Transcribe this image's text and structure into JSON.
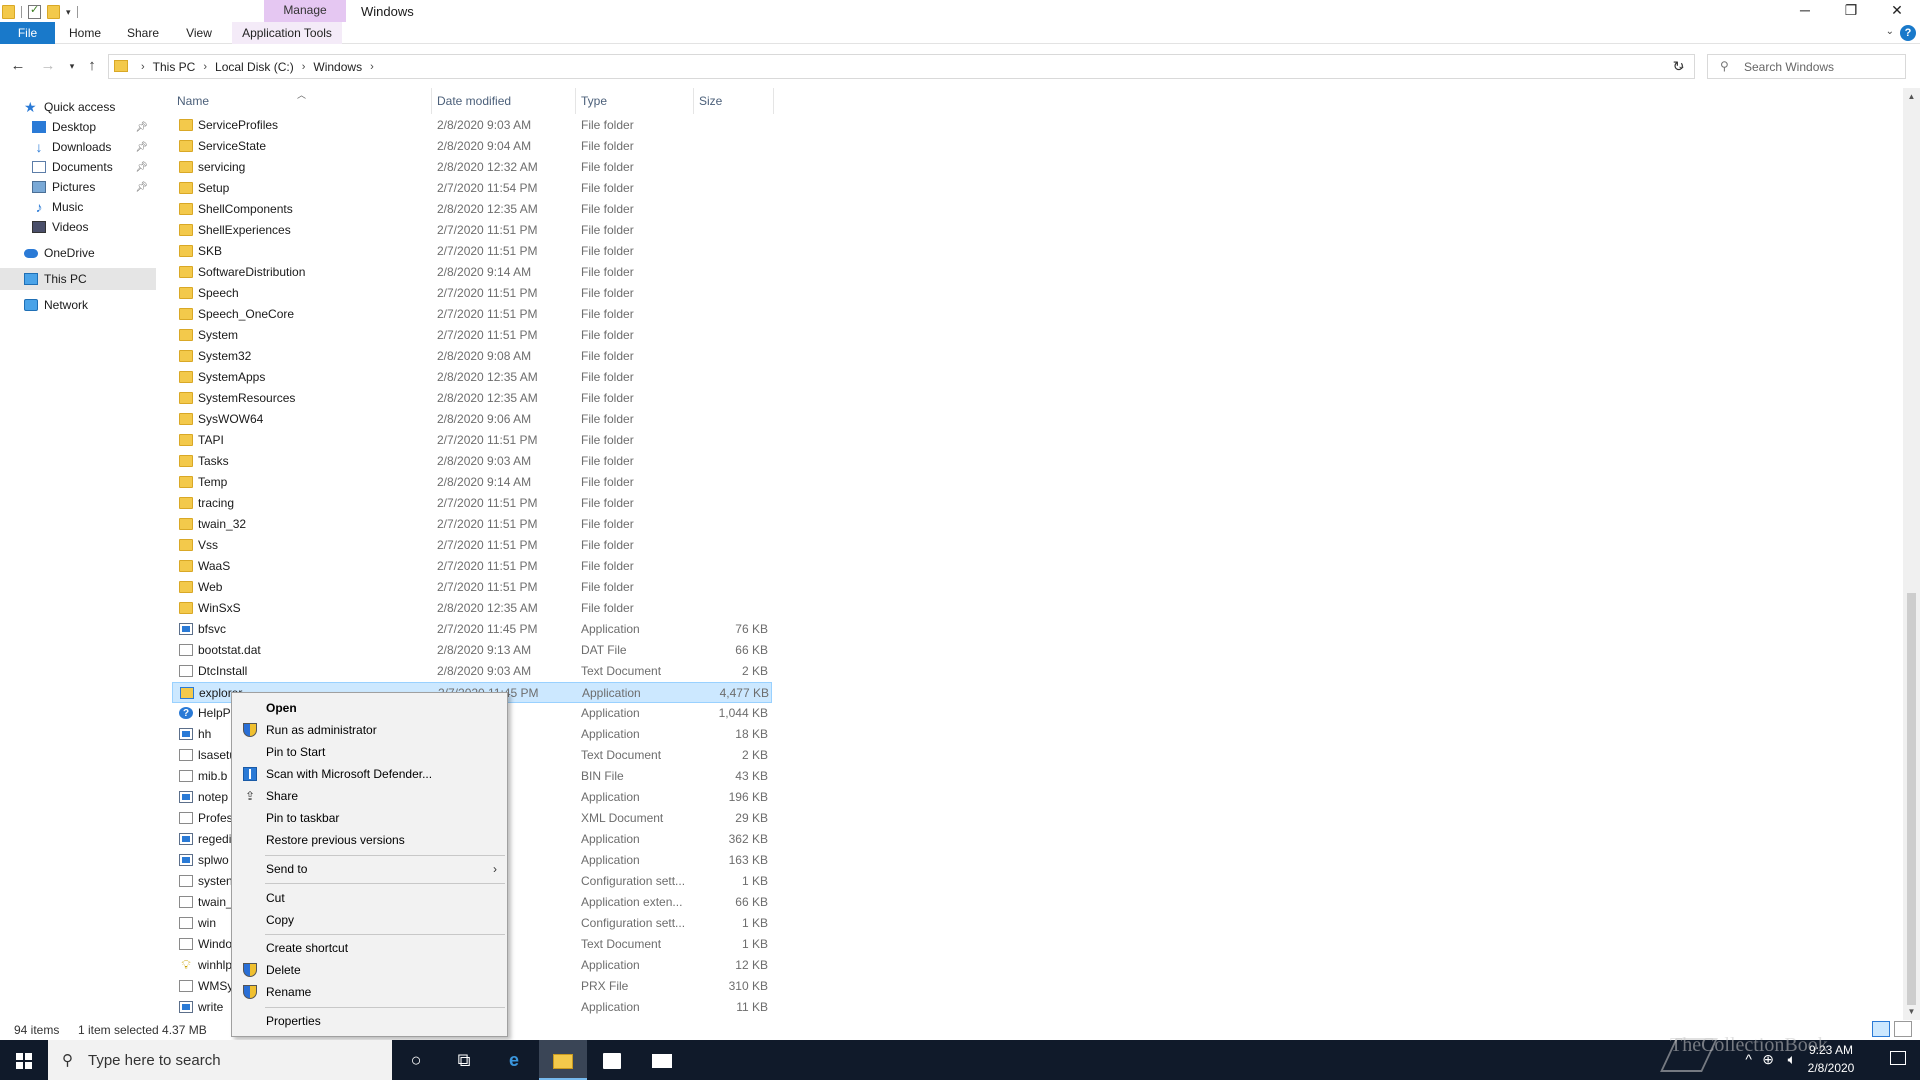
{
  "window": {
    "title": "Windows",
    "manage_tab": "Manage",
    "controls": {
      "minimize": "─",
      "restore": "❐",
      "close": "✕"
    }
  },
  "ribbon": {
    "file": "File",
    "home": "Home",
    "share": "Share",
    "view": "View",
    "app_tools": "Application Tools",
    "help": "?"
  },
  "address": {
    "crumbs": [
      "This PC",
      "Local Disk (C:)",
      "Windows"
    ],
    "search_placeholder": "Search Windows"
  },
  "nav": {
    "quick_access": "Quick access",
    "desktop": "Desktop",
    "downloads": "Downloads",
    "documents": "Documents",
    "pictures": "Pictures",
    "music": "Music",
    "videos": "Videos",
    "onedrive": "OneDrive",
    "this_pc": "This PC",
    "network": "Network"
  },
  "columns": {
    "name": "Name",
    "date": "Date modified",
    "type": "Type",
    "size": "Size"
  },
  "files": [
    {
      "name": "ServiceProfiles",
      "date": "2/8/2020 9:03 AM",
      "type": "File folder",
      "size": "",
      "icon": "folder"
    },
    {
      "name": "ServiceState",
      "date": "2/8/2020 9:04 AM",
      "type": "File folder",
      "size": "",
      "icon": "folder"
    },
    {
      "name": "servicing",
      "date": "2/8/2020 12:32 AM",
      "type": "File folder",
      "size": "",
      "icon": "folder"
    },
    {
      "name": "Setup",
      "date": "2/7/2020 11:54 PM",
      "type": "File folder",
      "size": "",
      "icon": "folder"
    },
    {
      "name": "ShellComponents",
      "date": "2/8/2020 12:35 AM",
      "type": "File folder",
      "size": "",
      "icon": "folder"
    },
    {
      "name": "ShellExperiences",
      "date": "2/7/2020 11:51 PM",
      "type": "File folder",
      "size": "",
      "icon": "folder"
    },
    {
      "name": "SKB",
      "date": "2/7/2020 11:51 PM",
      "type": "File folder",
      "size": "",
      "icon": "folder"
    },
    {
      "name": "SoftwareDistribution",
      "date": "2/8/2020 9:14 AM",
      "type": "File folder",
      "size": "",
      "icon": "folder"
    },
    {
      "name": "Speech",
      "date": "2/7/2020 11:51 PM",
      "type": "File folder",
      "size": "",
      "icon": "folder"
    },
    {
      "name": "Speech_OneCore",
      "date": "2/7/2020 11:51 PM",
      "type": "File folder",
      "size": "",
      "icon": "folder"
    },
    {
      "name": "System",
      "date": "2/7/2020 11:51 PM",
      "type": "File folder",
      "size": "",
      "icon": "folder"
    },
    {
      "name": "System32",
      "date": "2/8/2020 9:08 AM",
      "type": "File folder",
      "size": "",
      "icon": "folder"
    },
    {
      "name": "SystemApps",
      "date": "2/8/2020 12:35 AM",
      "type": "File folder",
      "size": "",
      "icon": "folder"
    },
    {
      "name": "SystemResources",
      "date": "2/8/2020 12:35 AM",
      "type": "File folder",
      "size": "",
      "icon": "folder"
    },
    {
      "name": "SysWOW64",
      "date": "2/8/2020 9:06 AM",
      "type": "File folder",
      "size": "",
      "icon": "folder"
    },
    {
      "name": "TAPI",
      "date": "2/7/2020 11:51 PM",
      "type": "File folder",
      "size": "",
      "icon": "folder"
    },
    {
      "name": "Tasks",
      "date": "2/8/2020 9:03 AM",
      "type": "File folder",
      "size": "",
      "icon": "folder"
    },
    {
      "name": "Temp",
      "date": "2/8/2020 9:14 AM",
      "type": "File folder",
      "size": "",
      "icon": "folder"
    },
    {
      "name": "tracing",
      "date": "2/7/2020 11:51 PM",
      "type": "File folder",
      "size": "",
      "icon": "folder"
    },
    {
      "name": "twain_32",
      "date": "2/7/2020 11:51 PM",
      "type": "File folder",
      "size": "",
      "icon": "folder"
    },
    {
      "name": "Vss",
      "date": "2/7/2020 11:51 PM",
      "type": "File folder",
      "size": "",
      "icon": "folder"
    },
    {
      "name": "WaaS",
      "date": "2/7/2020 11:51 PM",
      "type": "File folder",
      "size": "",
      "icon": "folder"
    },
    {
      "name": "Web",
      "date": "2/7/2020 11:51 PM",
      "type": "File folder",
      "size": "",
      "icon": "folder"
    },
    {
      "name": "WinSxS",
      "date": "2/8/2020 12:35 AM",
      "type": "File folder",
      "size": "",
      "icon": "folder"
    },
    {
      "name": "bfsvc",
      "date": "2/7/2020 11:45 PM",
      "type": "Application",
      "size": "76 KB",
      "icon": "app"
    },
    {
      "name": "bootstat.dat",
      "date": "2/8/2020 9:13 AM",
      "type": "DAT File",
      "size": "66 KB",
      "icon": "file"
    },
    {
      "name": "DtcInstall",
      "date": "2/8/2020 9:03 AM",
      "type": "Text Document",
      "size": "2 KB",
      "icon": "file"
    },
    {
      "name": "explorer",
      "date": "2/7/2020 11:45 PM",
      "type": "Application",
      "size": "4,477 KB",
      "icon": "explorer",
      "selected": true
    },
    {
      "name": "HelpP",
      "date": "7 PM",
      "type": "Application",
      "size": "1,044 KB",
      "icon": "help"
    },
    {
      "name": "hh",
      "date": "7 PM",
      "type": "Application",
      "size": "18 KB",
      "icon": "app"
    },
    {
      "name": "lsasetu",
      "date": "AM",
      "type": "Text Document",
      "size": "2 KB",
      "icon": "file"
    },
    {
      "name": "mib.b",
      "date": "5 PM",
      "type": "BIN File",
      "size": "43 KB",
      "icon": "file"
    },
    {
      "name": "notep",
      "date": "8 PM",
      "type": "Application",
      "size": "196 KB",
      "icon": "app"
    },
    {
      "name": "Profes",
      "date": "8 PM",
      "type": "XML Document",
      "size": "29 KB",
      "icon": "file"
    },
    {
      "name": "regedi",
      "date": "7 PM",
      "type": "Application",
      "size": "362 KB",
      "icon": "app"
    },
    {
      "name": "splwo",
      "date": "5 PM",
      "type": "Application",
      "size": "163 KB",
      "icon": "app"
    },
    {
      "name": "systen",
      "date": "9 PM",
      "type": "Configuration sett...",
      "size": "1 KB",
      "icon": "file"
    },
    {
      "name": "twain_",
      "date": "7 PM",
      "type": "Application exten...",
      "size": "66 KB",
      "icon": "file"
    },
    {
      "name": "win",
      "date": "9 PM",
      "type": "Configuration sett...",
      "size": "1 KB",
      "icon": "file"
    },
    {
      "name": "Windo",
      "date": "AM",
      "type": "Text Document",
      "size": "1 KB",
      "icon": "file"
    },
    {
      "name": "winhlp",
      "date": "7 PM",
      "type": "Application",
      "size": "12 KB",
      "icon": "bulb"
    },
    {
      "name": "WMSy",
      "date": "5 AM",
      "type": "PRX File",
      "size": "310 KB",
      "icon": "file"
    },
    {
      "name": "write",
      "date": "4 PM",
      "type": "Application",
      "size": "11 KB",
      "icon": "app"
    }
  ],
  "context_menu": {
    "open": "Open",
    "run_admin": "Run as administrator",
    "pin_start": "Pin to Start",
    "scan_defender": "Scan with Microsoft Defender...",
    "share": "Share",
    "pin_taskbar": "Pin to taskbar",
    "restore_versions": "Restore previous versions",
    "send_to": "Send to",
    "cut": "Cut",
    "copy": "Copy",
    "create_shortcut": "Create shortcut",
    "delete": "Delete",
    "rename": "Rename",
    "properties": "Properties"
  },
  "status": {
    "count": "94 items",
    "selection": "1 item selected  4.37 MB"
  },
  "taskbar": {
    "search_text": "Type here to search",
    "time": "9:23 AM",
    "date": "2/8/2020"
  },
  "watermark": "TheCollectionBook",
  "colors": {
    "accent": "#1979ca",
    "selection": "#cce8ff",
    "manage_tab": "#e5c7f2",
    "taskbar": "#101a2a"
  }
}
